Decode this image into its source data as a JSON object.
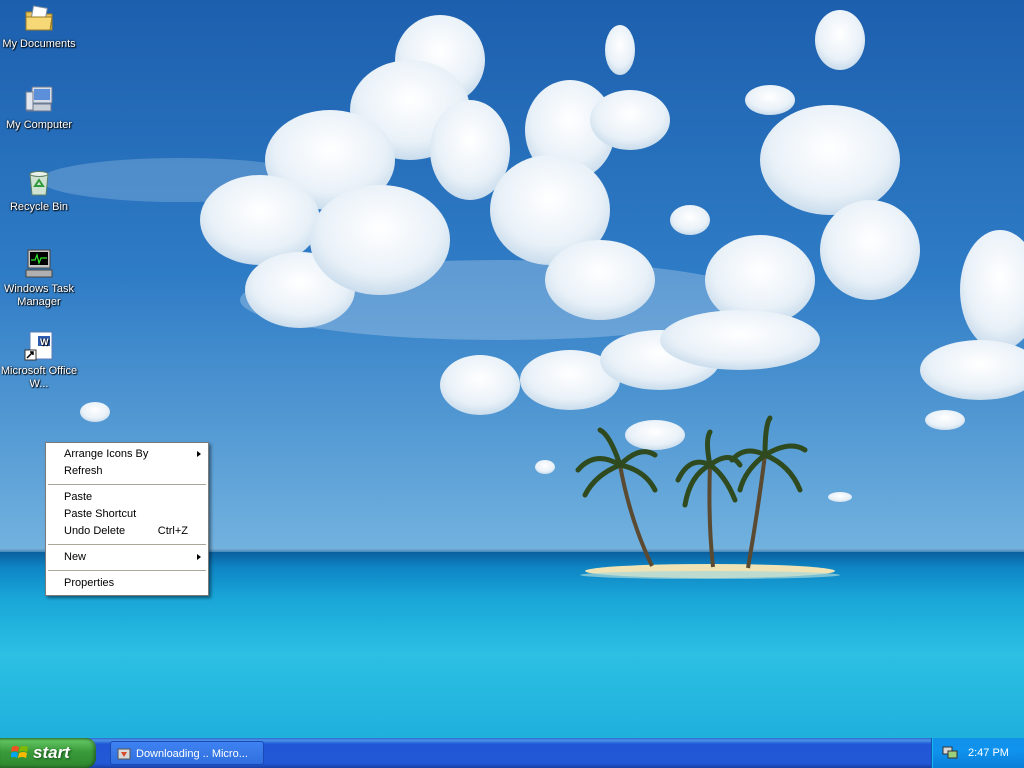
{
  "desktop": {
    "icons": [
      {
        "label": "My Documents",
        "icon": "folder-documents-icon"
      },
      {
        "label": "My Computer",
        "icon": "computer-icon"
      },
      {
        "label": "Recycle Bin",
        "icon": "recycle-bin-icon"
      },
      {
        "label": "Windows Task Manager",
        "icon": "task-manager-icon"
      },
      {
        "label": "Microsoft Office W...",
        "icon": "word-document-icon"
      }
    ]
  },
  "context_menu": {
    "items": [
      {
        "label": "Arrange Icons By",
        "submenu": true
      },
      {
        "label": "Refresh"
      },
      {
        "label": "Paste"
      },
      {
        "label": "Paste Shortcut"
      },
      {
        "label": "Undo Delete",
        "shortcut": "Ctrl+Z"
      },
      {
        "label": "New",
        "submenu": true
      },
      {
        "label": "Properties"
      }
    ]
  },
  "taskbar": {
    "start_label": "start",
    "task_label": "Downloading .. Micro...",
    "clock": "2:47 PM"
  },
  "colors": {
    "taskbar_blue": "#2257d5",
    "start_green": "#3a9b3a",
    "tray_blue": "#0f93ee"
  }
}
